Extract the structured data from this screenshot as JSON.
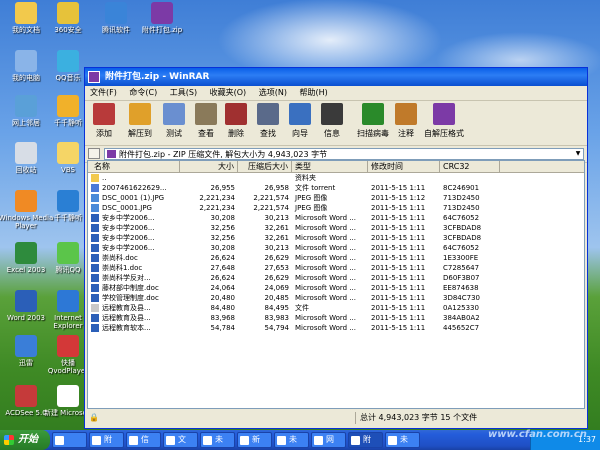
{
  "desktop": {
    "icons": [
      {
        "label": "我的文档",
        "color": "#f2c94c",
        "icon": "my-documents-icon"
      },
      {
        "label": "我的电脑",
        "color": "#8ab4e8",
        "icon": "my-computer-icon"
      },
      {
        "label": "网上邻居",
        "color": "#5aa0d8",
        "icon": "network-places-icon"
      },
      {
        "label": "回收站",
        "color": "#d7dde6",
        "icon": "recycle-bin-icon"
      },
      {
        "label": "Windows Media Player",
        "color": "#f08a24",
        "icon": "media-player-icon"
      },
      {
        "label": "Excel 2003",
        "color": "#2e8b3d",
        "icon": "excel-icon"
      },
      {
        "label": "Word 2003",
        "color": "#2b5fb8",
        "icon": "word-icon"
      },
      {
        "label": "迅雷",
        "color": "#3a7ed8",
        "icon": "xunlei-icon"
      },
      {
        "label": "ACDSee 5.0",
        "color": "#c53a3a",
        "icon": "acdsee-icon"
      },
      {
        "label": "360安全",
        "color": "#e6c23a",
        "icon": "security-icon"
      },
      {
        "label": "QQ音乐",
        "color": "#3bb0e0",
        "icon": "qq-music-icon"
      },
      {
        "label": "千千静听",
        "color": "#f1b12a",
        "icon": "player-icon"
      },
      {
        "label": "VBS",
        "color": "#f5d566",
        "icon": "folder-icon"
      },
      {
        "label": "千千静听",
        "color": "#2a7fd4",
        "icon": "ttplayer-icon"
      },
      {
        "label": "腾讯QQ",
        "color": "#5bc54a",
        "icon": "qq-icon"
      },
      {
        "label": "Internet Explorer",
        "color": "#2d78d6",
        "icon": "ie-icon"
      },
      {
        "label": "快播 QvodPlayer",
        "color": "#d33838",
        "icon": "qvod-icon"
      },
      {
        "label": "新建 Microsoft",
        "color": "#ffffff",
        "icon": "word-doc-icon"
      },
      {
        "label": "腾讯软件",
        "color": "#3a84d8",
        "icon": "tencent-icon"
      },
      {
        "label": "附件打包.zip",
        "color": "#7c3aa6",
        "icon": "zip-icon"
      }
    ]
  },
  "window": {
    "title": "附件打包.zip - WinRAR",
    "menu": [
      "文件(F)",
      "命令(C)",
      "工具(S)",
      "收藏夹(O)",
      "选项(N)",
      "帮助(H)"
    ],
    "toolbar": [
      {
        "label": "添加",
        "color": "#b83a3a",
        "icon": "add-icon"
      },
      {
        "label": "解压到",
        "color": "#e0a02a",
        "icon": "extract-icon"
      },
      {
        "label": "测试",
        "color": "#6a8fd0",
        "icon": "test-icon"
      },
      {
        "label": "查看",
        "color": "#8a7a5a",
        "icon": "view-icon"
      },
      {
        "label": "删除",
        "color": "#a03030",
        "icon": "delete-icon"
      },
      {
        "label": "查找",
        "color": "#5a6a8a",
        "icon": "find-icon"
      },
      {
        "label": "向导",
        "color": "#3a70c0",
        "icon": "wizard-icon"
      },
      {
        "label": "信息",
        "color": "#3a3a3a",
        "icon": "info-icon"
      },
      {
        "label": "扫描病毒",
        "color": "#2a8a2a",
        "icon": "virus-scan-icon"
      },
      {
        "label": "注释",
        "color": "#c07a2a",
        "icon": "comment-icon"
      },
      {
        "label": "自解压格式",
        "color": "#7c3aa6",
        "icon": "sfx-icon"
      }
    ],
    "address": "附件打包.zip - ZIP 压缩文件, 解包大小为 4,943,023 字节",
    "columns": {
      "name": "名称",
      "size": "大小",
      "packed": "压缩后大小",
      "type": "类型",
      "modified": "修改时间",
      "crc": "CRC32"
    },
    "files": [
      {
        "name": "..",
        "size": "",
        "packed": "",
        "type": "资料夹",
        "modified": "",
        "crc": "",
        "color": "#f2c94c"
      },
      {
        "name": "2007461622629...",
        "size": "26,955",
        "packed": "26,958",
        "type": "文件 torrent",
        "modified": "2011-5-15 1:11",
        "crc": "8C246901",
        "color": "#4a7ad8"
      },
      {
        "name": "DSC_0001 (1).JPG",
        "size": "2,221,234",
        "packed": "2,221,574",
        "type": "JPEG 图像",
        "modified": "2011-5-15 1:12",
        "crc": "713D2450",
        "color": "#4a8ad8"
      },
      {
        "name": "DSC_0001.JPG",
        "size": "2,221,234",
        "packed": "2,221,574",
        "type": "JPEG 图像",
        "modified": "2011-5-15 1:11",
        "crc": "713D2450",
        "color": "#4a8ad8"
      },
      {
        "name": "安乡中学2006...",
        "size": "30,208",
        "packed": "30,213",
        "type": "Microsoft Word ...",
        "modified": "2011-5-15 1:11",
        "crc": "64C76052",
        "color": "#2b5fb8"
      },
      {
        "name": "安乡中学2006...",
        "size": "32,256",
        "packed": "32,261",
        "type": "Microsoft Word ...",
        "modified": "2011-5-15 1:11",
        "crc": "3CFBDAD8",
        "color": "#2b5fb8"
      },
      {
        "name": "安乡中学2006...",
        "size": "32,256",
        "packed": "32,261",
        "type": "Microsoft Word ...",
        "modified": "2011-5-15 1:11",
        "crc": "3CFBDAD8",
        "color": "#2b5fb8"
      },
      {
        "name": "安乡中学2006...",
        "size": "30,208",
        "packed": "30,213",
        "type": "Microsoft Word ...",
        "modified": "2011-5-15 1:11",
        "crc": "64C76052",
        "color": "#2b5fb8"
      },
      {
        "name": "崇尚科.doc",
        "size": "26,624",
        "packed": "26,629",
        "type": "Microsoft Word ...",
        "modified": "2011-5-15 1:11",
        "crc": "1E3300FE",
        "color": "#2b5fb8"
      },
      {
        "name": "崇尚科1.doc",
        "size": "27,648",
        "packed": "27,653",
        "type": "Microsoft Word ...",
        "modified": "2011-5-15 1:11",
        "crc": "C7285647",
        "color": "#2b5fb8"
      },
      {
        "name": "崇尚科学反对...",
        "size": "26,624",
        "packed": "26,629",
        "type": "Microsoft Word ...",
        "modified": "2011-5-15 1:11",
        "crc": "D60F3B07",
        "color": "#2b5fb8"
      },
      {
        "name": "藤材部中制度.doc",
        "size": "24,064",
        "packed": "24,069",
        "type": "Microsoft Word ...",
        "modified": "2011-5-15 1:11",
        "crc": "EE874638",
        "color": "#2b5fb8"
      },
      {
        "name": "学校管理制度.doc",
        "size": "20,480",
        "packed": "20,485",
        "type": "Microsoft Word ...",
        "modified": "2011-5-15 1:11",
        "crc": "3D84C730",
        "color": "#2b5fb8"
      },
      {
        "name": "远程教育及县...",
        "size": "84,480",
        "packed": "84,495",
        "type": "文件",
        "modified": "2011-5-15 1:11",
        "crc": "0A125330",
        "color": "#c8c8c8"
      },
      {
        "name": "远程教育及县...",
        "size": "83,968",
        "packed": "83,983",
        "type": "Microsoft Word ...",
        "modified": "2011-5-15 1:11",
        "crc": "384AB0A2",
        "color": "#2b5fb8"
      },
      {
        "name": "远程教育软本...",
        "size": "54,784",
        "packed": "54,794",
        "type": "Microsoft Word ...",
        "modified": "2011-5-15 1:11",
        "crc": "445652C7",
        "color": "#2b5fb8"
      }
    ],
    "status": "总计 4,943,023 字节 15 个文件"
  },
  "taskbar": {
    "start": "开始",
    "buttons": [
      "",
      "附",
      "信",
      "文",
      "未",
      "新",
      "未",
      "网",
      "附",
      "未"
    ],
    "time": "1:37"
  },
  "watermark": "www.cfan.com.cn"
}
